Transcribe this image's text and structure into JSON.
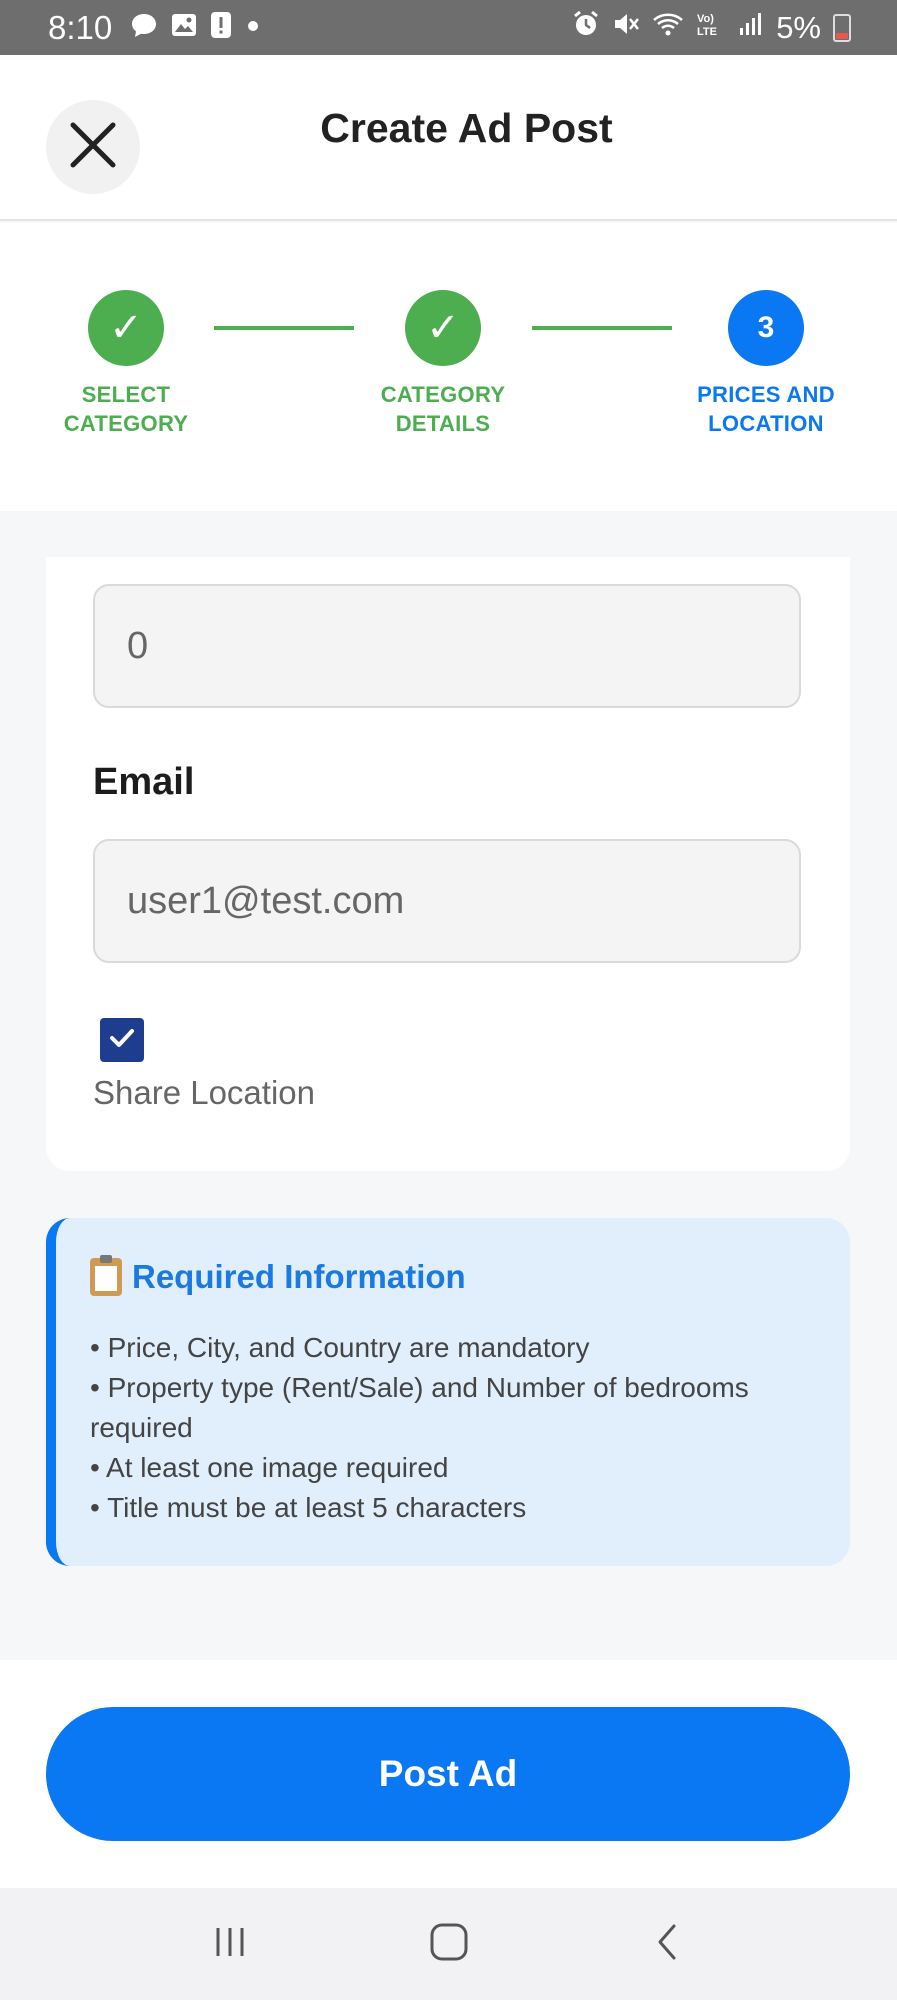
{
  "status_bar": {
    "time": "8:10",
    "battery": "5%",
    "left_icons": [
      "chat-icon",
      "image-icon",
      "alert-icon",
      "dot-icon"
    ],
    "right_icons": [
      "alarm-icon",
      "mute-icon",
      "wifi-icon",
      "volte-icon",
      "signal-icon",
      "battery-icon"
    ]
  },
  "header": {
    "title": "Create Ad Post",
    "close_icon": "close-icon"
  },
  "stepper": {
    "steps": [
      {
        "label": "SELECT\nCATEGORY",
        "line1": "SELECT",
        "line2": "CATEGORY",
        "state": "done",
        "mark": "✓"
      },
      {
        "label": "CATEGORY DETAILS",
        "line1": "CATEGORY",
        "line2": "DETAILS",
        "state": "done",
        "mark": "✓"
      },
      {
        "label": "PRICES AND LOCATION",
        "line1": "PRICES AND",
        "line2": "LOCATION",
        "state": "active",
        "mark": "3"
      }
    ]
  },
  "form": {
    "price_value": "0",
    "email_label": "Email",
    "email_value": "user1@test.com",
    "share_location_checked": true,
    "share_location_label": "Share Location"
  },
  "info": {
    "title": "Required Information",
    "items": [
      "• Price, City, and Country are mandatory",
      "• Property type (Rent/Sale) and Number of bedrooms required",
      "• At least one image required",
      "• Title must be at least 5 characters"
    ]
  },
  "actions": {
    "post_label": "Post Ad"
  },
  "colors": {
    "accent": "#0a78f3",
    "done": "#4cae4f",
    "checkbox": "#1f3d8f"
  }
}
